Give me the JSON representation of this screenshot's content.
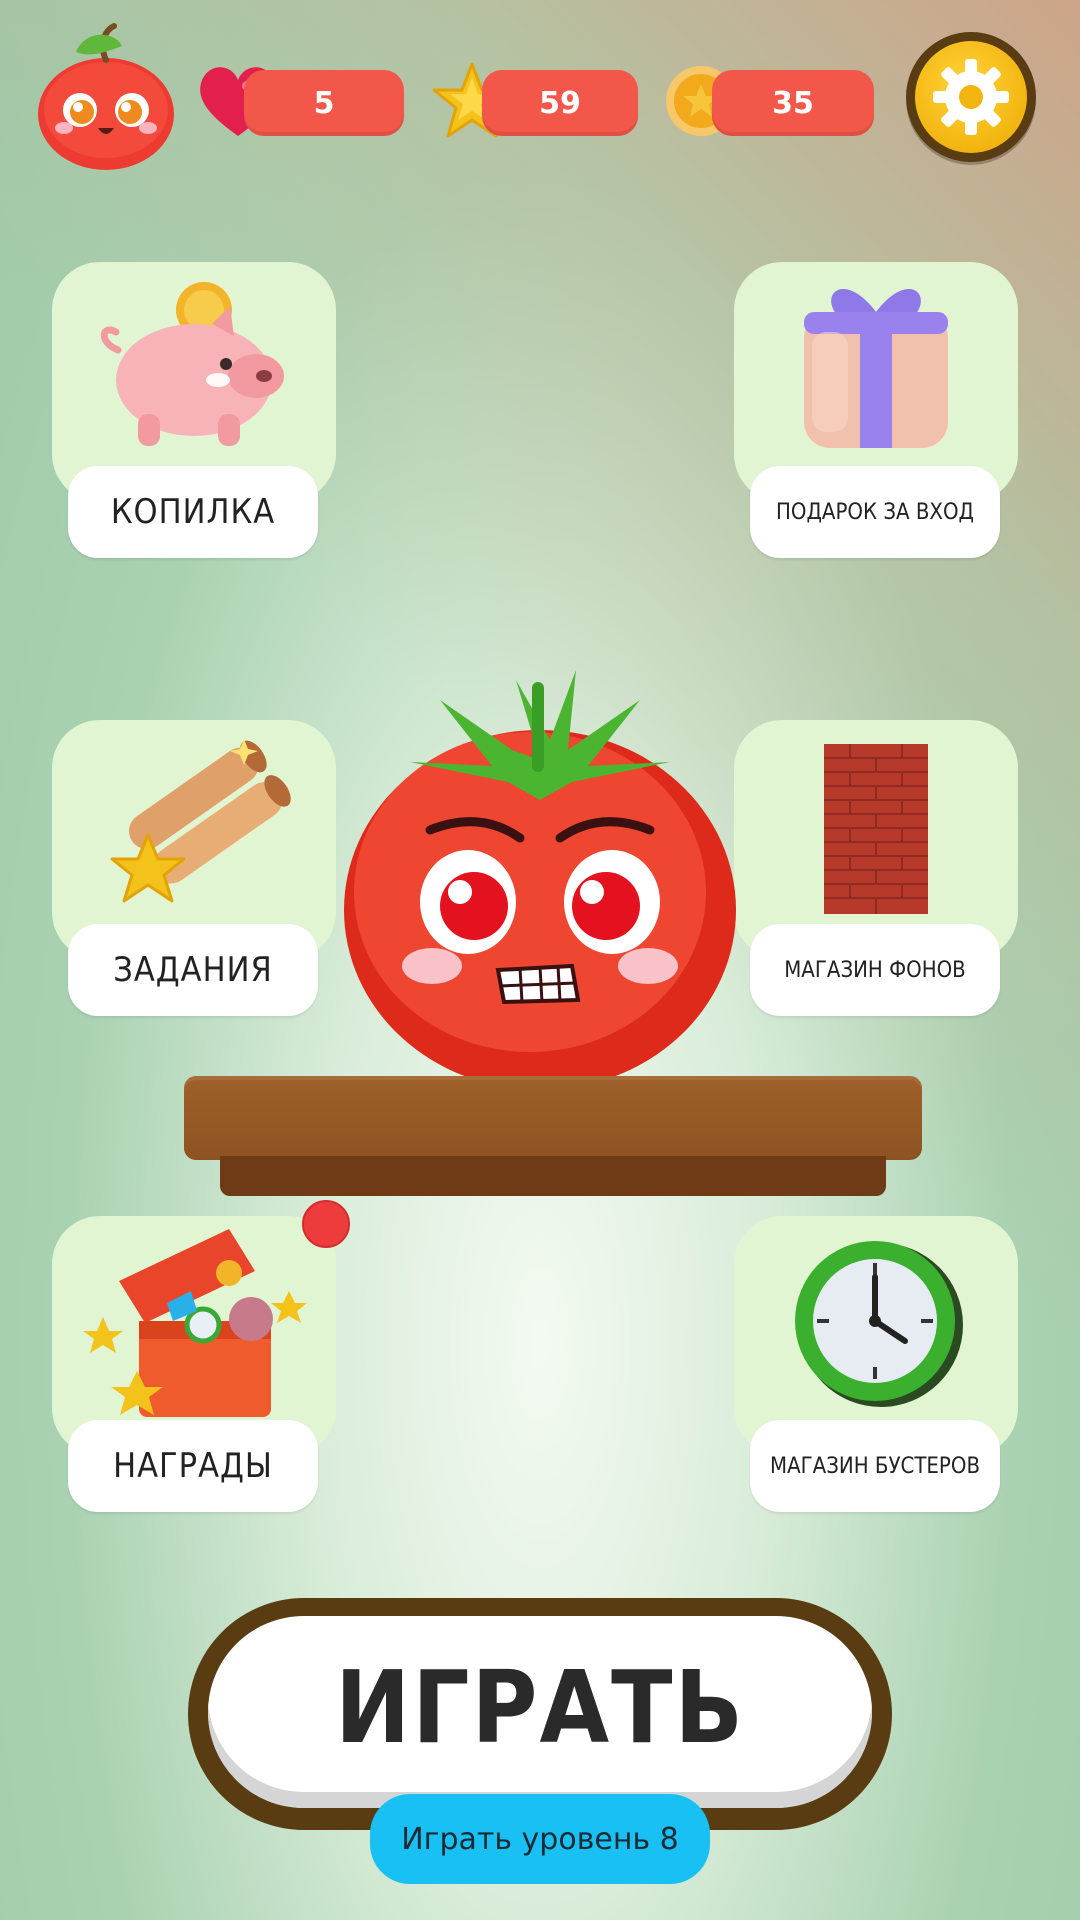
{
  "hud": {
    "lives": "5",
    "stars": "59",
    "coins": "35",
    "colors": {
      "pill": "#f2574a",
      "settings_ring": "#5a3c12",
      "settings_gear": "#f2b510"
    }
  },
  "tiles": {
    "piggy_bank": "КОПИЛКА",
    "daily_gift": "ПОДАРОК ЗА ВХОД",
    "tasks": "ЗАДАНИЯ",
    "background_shop": "МАГАЗИН ФОНОВ",
    "rewards": "НАГРАДЫ",
    "booster_shop": "МАГАЗИН БУСТЕРОВ"
  },
  "play": {
    "label": "ИГРАТЬ",
    "level_label": "Играть уровень 8"
  },
  "icons": [
    "apple-avatar-icon",
    "heart-icon",
    "star-icon",
    "coin-icon",
    "gear-icon",
    "piggy-bank-icon",
    "gift-icon",
    "scrolls-icon",
    "brick-wall-icon",
    "treasure-chest-icon",
    "clock-icon"
  ]
}
